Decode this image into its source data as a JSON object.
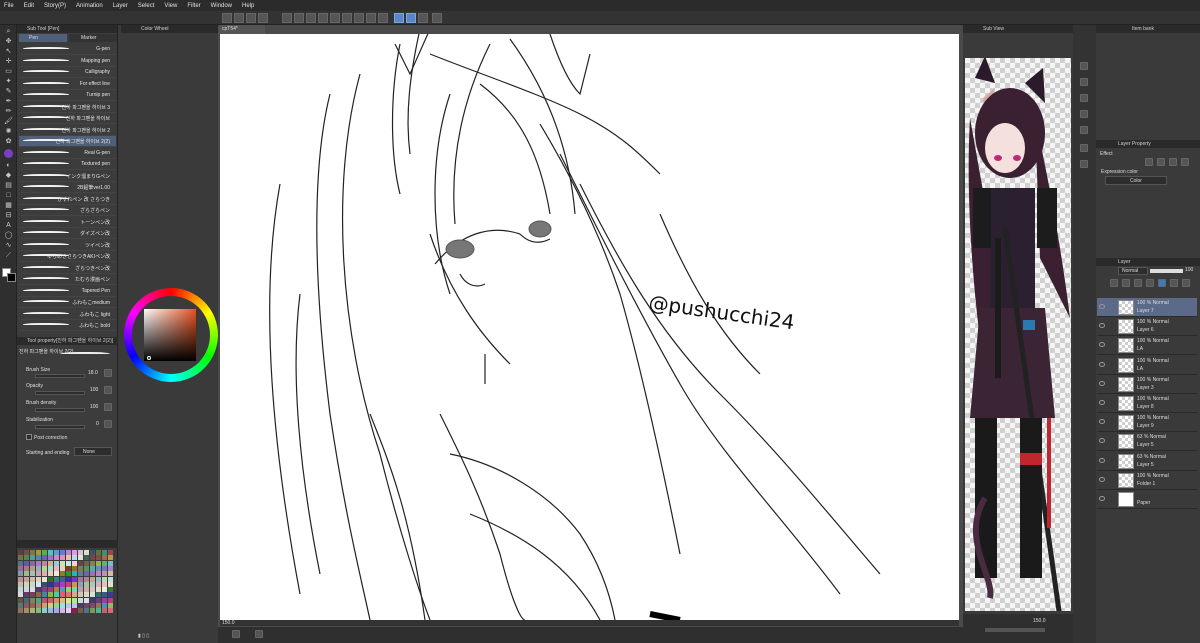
{
  "menu": [
    "File",
    "Edit",
    "Story(P)",
    "Animation",
    "Layer",
    "Select",
    "View",
    "Filter",
    "Window",
    "Help"
  ],
  "subtool_panel": {
    "title": "Sub Tool [Pen]",
    "tabs": [
      "Pen",
      "Marker"
    ],
    "brushes": [
      "G-pen",
      "Mapping pen",
      "Calligraphy",
      "For effect line",
      "Turnip pen",
      "진하 파그펜을 하이브 3",
      "진하 파그펜을 하이브",
      "진하 파그펜을 하이브 2",
      "진하 파그펜을 하이브 2(2)",
      "Real G-pen",
      "Textured pen",
      "インク溜まりGペン",
      "2B鉛筆ver1.00",
      "かすれペン 改 さらつき",
      "ざらざらペン",
      "トーンペン改",
      "ダイズペン改",
      "ツイペン改",
      "ゆらめきさらつきAKIペン改",
      "ざらつきペン改",
      "たむら漫画ペン",
      "Tapered Pen",
      "ふわもこmedium",
      "ふわもこ light",
      "ふわもこ bold"
    ],
    "selected_brush_index": 8
  },
  "tool_property": {
    "title": "Tool property[진하 파그펜을 하이브 2(2)]",
    "current_brush": "진하 파그펜을 하이브 2(2)",
    "brush_size_label": "Brush Size",
    "brush_size_value": "18.0",
    "opacity_label": "Opacity",
    "opacity_value": "100",
    "brush_density_label": "Brush density",
    "brush_density_value": "100",
    "stabilization_label": "Stabilization",
    "stabilization_value": "0",
    "post_correction_label": "Post correction",
    "starting_ending_label": "Starting and ending",
    "starting_ending_value": "None"
  },
  "color_wheel": {
    "title": "Color Wheel"
  },
  "canvas": {
    "tab_title": "cpT54*",
    "zoom": "150.0",
    "signature": "@pushucchi24"
  },
  "sub_view": {
    "title": "Sub View",
    "zoom": "150.0"
  },
  "item_bank": {
    "title": "Item bank"
  },
  "layer_property": {
    "title": "Layer Property",
    "effect_label": "Effect",
    "expression_color_label": "Expression color",
    "expression_color_value": "Color"
  },
  "layer_panel": {
    "title": "Layer",
    "blend_mode": "Normal",
    "opacity": "100",
    "layers": [
      {
        "l1": "100 % Normal",
        "l2": "Layer 7"
      },
      {
        "l1": "100 % Normal",
        "l2": "Layer 6"
      },
      {
        "l1": "100 % Normal",
        "l2": "LA"
      },
      {
        "l1": "100 % Normal",
        "l2": "LA"
      },
      {
        "l1": "100 % Normal",
        "l2": "Layer 3"
      },
      {
        "l1": "100 % Normal",
        "l2": "Layer 8"
      },
      {
        "l1": "100 % Normal",
        "l2": "Layer 9"
      },
      {
        "l1": "63 % Normal",
        "l2": "Layer 5"
      },
      {
        "l1": "63 % Normal",
        "l2": "Layer 5"
      },
      {
        "l1": "100 % Normal",
        "l2": "Folder 1"
      },
      {
        "l1": "",
        "l2": "Paper"
      }
    ],
    "selected_index": 0
  },
  "colors": {
    "accent": "#5a86c4",
    "panel_bg": "#3c3c3c",
    "dark_bg": "#2b2b2b",
    "selected_layer": "#5a6a88"
  }
}
